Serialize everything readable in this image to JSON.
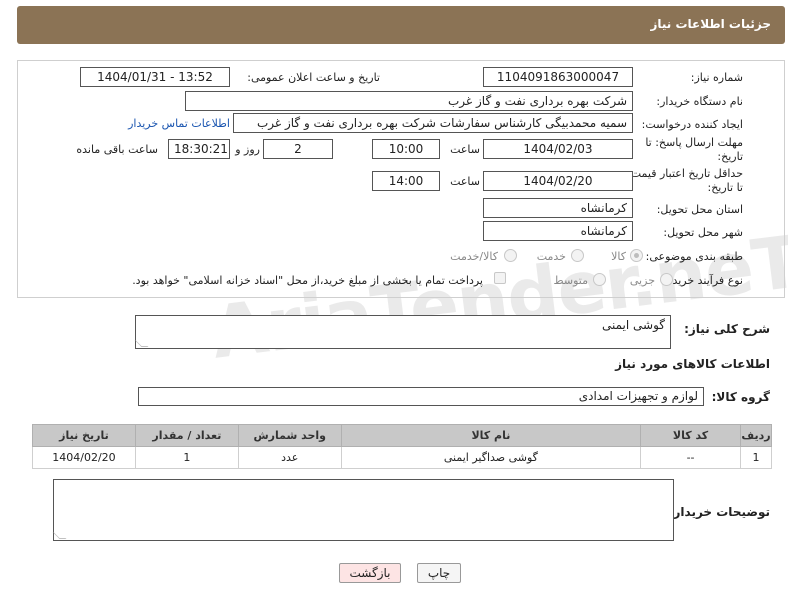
{
  "header": {
    "title": "جزئیات اطلاعات نیاز"
  },
  "form": {
    "need_number": {
      "label": "شماره نیاز:",
      "value": "1104091863000047"
    },
    "announce_datetime": {
      "label": "تاریخ و ساعت اعلان عمومی:",
      "value": "1404/01/31 - 13:52"
    },
    "buyer_org": {
      "label": "نام دستگاه خریدار:",
      "value": "شرکت بهره برداری نفت و گاز غرب"
    },
    "requester": {
      "label": "ایجاد کننده درخواست:",
      "value": "سمیه محمدبیگی کارشناس سفارشات شرکت بهره برداری نفت و گاز غرب"
    },
    "buyer_contact_link": "اطلاعات تماس خریدار",
    "reply_deadline": {
      "label": "مهلت ارسال پاسخ: تا تاریخ:",
      "date": "1404/02/03",
      "time_label": "ساعت",
      "time": "10:00",
      "days": "2",
      "days_label": "روز و",
      "remaining": "18:30:21",
      "remaining_label": "ساعت باقی مانده"
    },
    "price_validity": {
      "label": "حداقل تاریخ اعتبار قیمت: تا تاریخ:",
      "date": "1404/02/20",
      "time_label": "ساعت",
      "time": "14:00"
    },
    "delivery_province": {
      "label": "استان محل تحویل:",
      "value": "کرمانشاه"
    },
    "delivery_city": {
      "label": "شهر محل تحویل:",
      "value": "کرمانشاه"
    },
    "category": {
      "label": "طبقه بندی موضوعی:",
      "options": [
        "کالا",
        "خدمت",
        "کالا/خدمت"
      ],
      "selected": "کالا"
    },
    "purchase_type": {
      "label": "نوع فرآیند خرید :",
      "options": [
        "جزیی",
        "متوسط"
      ],
      "note": "پرداخت تمام یا بخشی از مبلغ خرید،از محل \"اسناد خزانه اسلامی\" خواهد بود."
    }
  },
  "description": {
    "label": "شرح کلی نیاز:",
    "value": "گوشی ایمنی"
  },
  "goods_section_title": "اطلاعات کالاهای مورد نیاز",
  "goods_group": {
    "label": "گروه کالا:",
    "value": "لوازم و تجهیزات امدادی"
  },
  "table": {
    "headers": [
      "ردیف",
      "کد کالا",
      "نام کالا",
      "واحد شمارش",
      "تعداد / مقدار",
      "تاریخ نیاز"
    ],
    "rows": [
      [
        "1",
        "--",
        "گوشی صداگیر ایمنی",
        "عدد",
        "1",
        "1404/02/20"
      ]
    ]
  },
  "buyer_notes": {
    "label": "توضیحات خریدار:",
    "value": ""
  },
  "buttons": {
    "print": "چاپ",
    "back": "بازگشت"
  },
  "watermark": "AriaTender.neT"
}
